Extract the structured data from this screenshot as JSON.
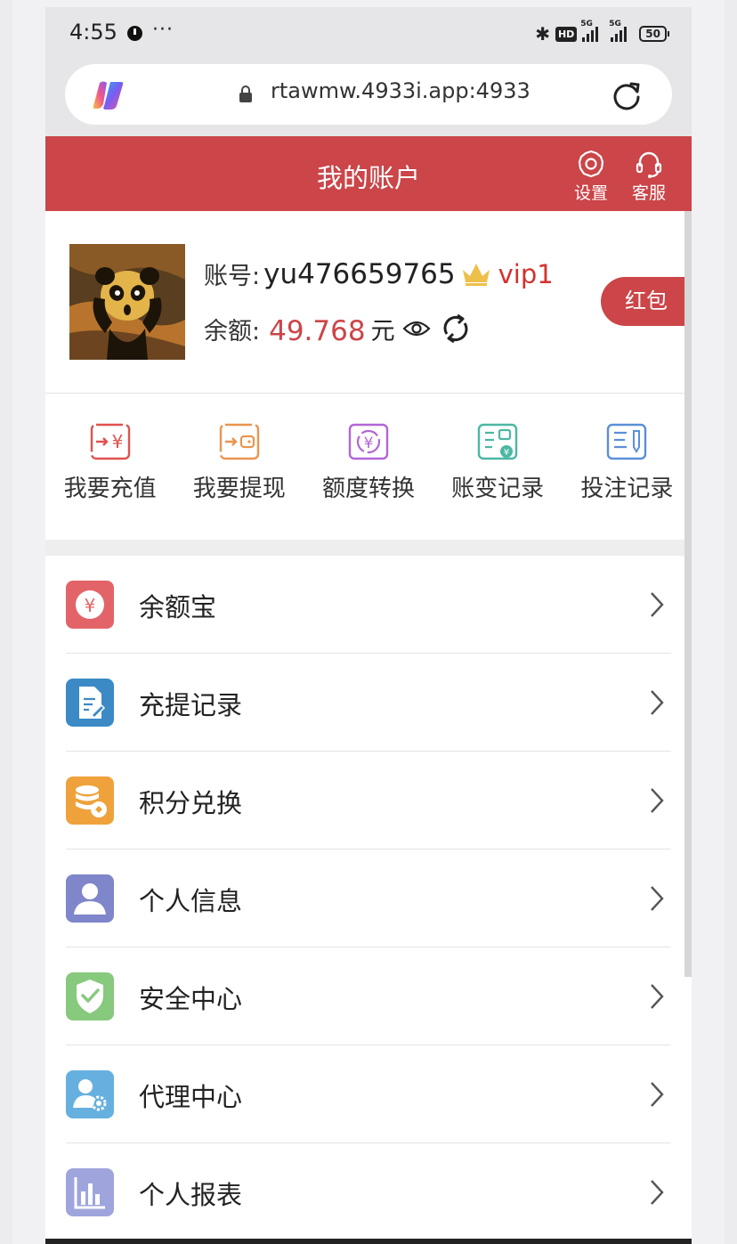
{
  "status_bar": {
    "time": "4:55",
    "more": "···",
    "hd": "HD",
    "network": "5G",
    "network2": "5G",
    "battery": "50"
  },
  "browser": {
    "url": "rtawmw.4933i.app:4933"
  },
  "header": {
    "title": "我的账户",
    "settings_label": "设置",
    "service_label": "客服"
  },
  "account": {
    "account_label": "账号:",
    "username": "yu476659765",
    "vip": "vip1",
    "balance_label": "余额:",
    "balance": "49.768",
    "currency": "元",
    "red_packet": "红包"
  },
  "quick_actions": [
    {
      "label": "我要充值",
      "icon": "recharge-icon",
      "color": "#e0524f"
    },
    {
      "label": "我要提现",
      "icon": "withdraw-icon",
      "color": "#e99550"
    },
    {
      "label": "额度转换",
      "icon": "transfer-icon",
      "color": "#b266d6"
    },
    {
      "label": "账变记录",
      "icon": "ledger-icon",
      "color": "#4cb7a3"
    },
    {
      "label": "投注记录",
      "icon": "bet-record-icon",
      "color": "#5b8fd8"
    }
  ],
  "menu": [
    {
      "label": "余额宝",
      "icon": "yuebao-icon",
      "color": "#e36468"
    },
    {
      "label": "充提记录",
      "icon": "record-icon",
      "color": "#3b8ac5"
    },
    {
      "label": "积分兑换",
      "icon": "points-icon",
      "color": "#efa23b"
    },
    {
      "label": "个人信息",
      "icon": "person-icon",
      "color": "#7f86c9"
    },
    {
      "label": "安全中心",
      "icon": "shield-icon",
      "color": "#87c97d"
    },
    {
      "label": "代理中心",
      "icon": "agent-icon",
      "color": "#66b0e0"
    },
    {
      "label": "个人报表",
      "icon": "report-icon",
      "color": "#9fa5dc"
    }
  ]
}
